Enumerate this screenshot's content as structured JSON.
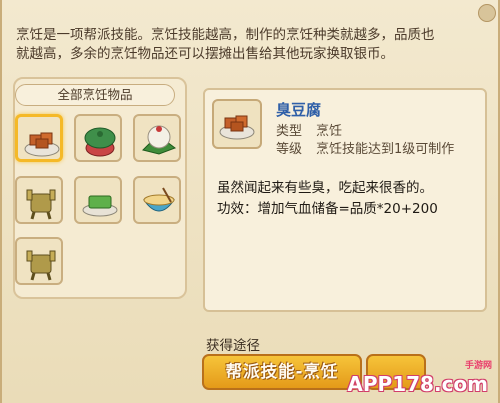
{
  "description": {
    "line1": "烹饪是一项帮派技能。烹饪技能越高，制作的烹饪种类就越多，品质也",
    "line2": "就越高，多余的烹饪物品还可以摆摊出售给其他玩家换取银币。"
  },
  "category_tab": "全部烹饪物品",
  "items": [
    {
      "icon": "tofu-icon",
      "selected": true
    },
    {
      "icon": "lotus-leaf-dish-icon",
      "selected": false
    },
    {
      "icon": "rice-dumpling-icon",
      "selected": false
    },
    {
      "icon": "bronze-cauldron-icon",
      "selected": false
    },
    {
      "icon": "green-cake-icon",
      "selected": false
    },
    {
      "icon": "noodle-bowl-icon",
      "selected": false
    },
    {
      "icon": "bronze-cauldron-icon",
      "selected": false
    }
  ],
  "detail": {
    "name": "臭豆腐",
    "type_key": "类型",
    "type_value": "烹饪",
    "level_key": "等级",
    "level_value": "烹饪技能达到1级可制作",
    "flavor_text": "虽然闻起来有些臭，吃起来很香的。",
    "effect_text": "功效：增加气血储备=品质*20+200"
  },
  "source": {
    "label": "获得途径",
    "button_label": "帮派技能-烹饪"
  },
  "watermark": {
    "text": "APP178.com",
    "sub": "手游网"
  },
  "colors": {
    "accent": "#f5b927",
    "name": "#2f5fa8",
    "button": "#e49a19"
  }
}
